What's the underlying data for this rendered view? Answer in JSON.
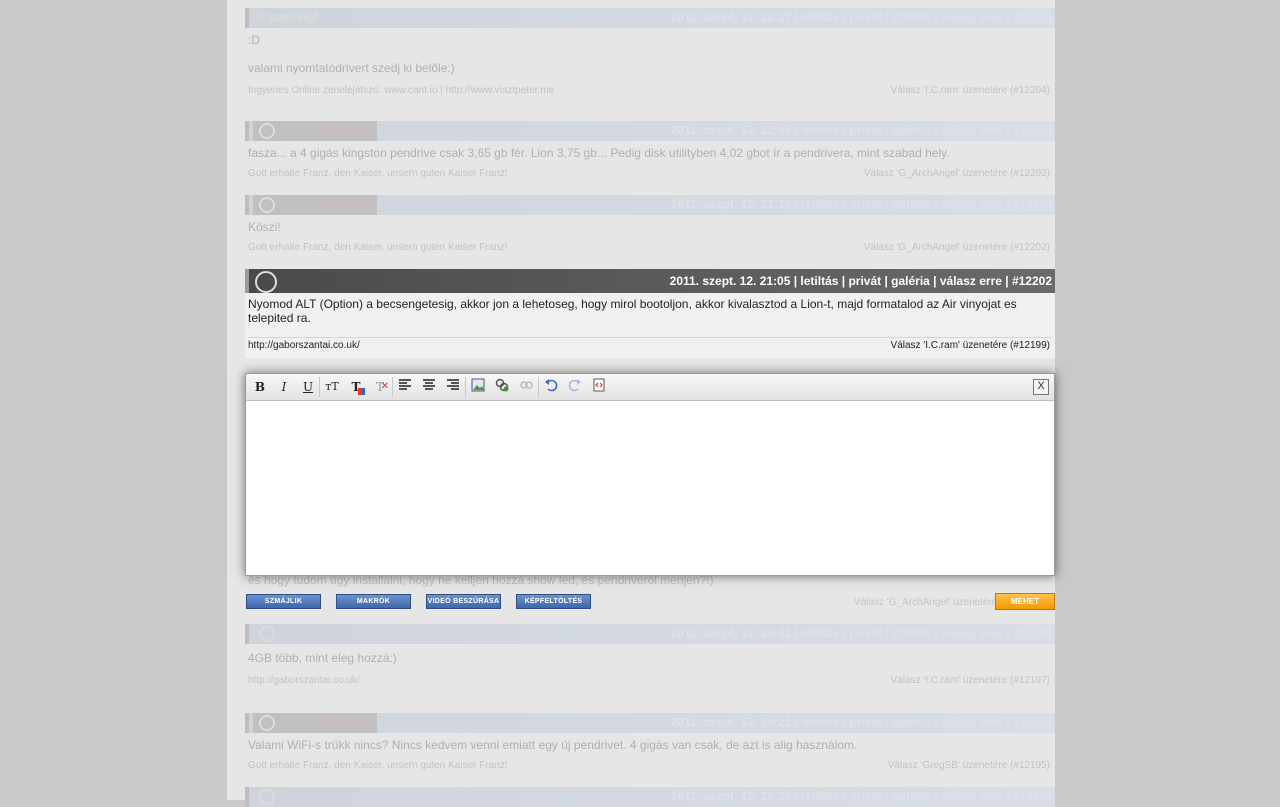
{
  "posts_top": [
    {
      "user": "© passaigt",
      "meta": "2011. szept. 12. 22:17 | letiltás | privát | galéria | válasz erre | #12205",
      "lines": [
        ":D",
        "valami nyomtatódrivert szedj ki belőle:)"
      ],
      "signature": "Ingyenes Online zenelejátszó: www.cant.io | http://www.vísztpeter.me",
      "reply": "Válasz 'I.C.ram' üzenetére (#12204)"
    },
    {
      "user": "I.C.ram",
      "meta": "2011. szept. 12. 22:05 | letiltás | privát | galéria | válasz erre | #12204",
      "lines": [
        "fasza... a 4 gigás kingston pendrive csak 3,65 gb fér. Lion 3,75 gb... Pedig disk utilityben 4,02 gbot ír a pendrivera, mint szabad hely."
      ],
      "signature": "Gott erhalte Franz, den Kaiser, unsern guten Kaiser Franz!",
      "reply": "Válasz 'G_ArchAngel' üzenetére (#12202)"
    },
    {
      "user": "I.C.ram",
      "meta": "2011. szept. 12. 21:14 | letiltás | privát | galéria | válasz erre | #12203",
      "lines": [
        "Köszi!"
      ],
      "signature": "Gott erhalte Franz, den Kaiser, unsern guten Kaiser Franz!",
      "reply": "Válasz 'G_ArchAngel' üzenetére (#12202)"
    }
  ],
  "highlight": {
    "meta": "2011. szept. 12. 21:05 | letiltás | privát | galéria | válasz erre | #12202",
    "body": "Nyomod ALT (Option) a becsengetesig, akkor jon a lehetoseg, hogy mirol bootoljon, akkor kivalasztod a Lion-t, majd formatalod az Air vinyojat es telepited ra.",
    "signature": "http://gaborszantai.co.uk/",
    "reply": "Válasz 'I.C.ram' üzenetére (#12199)"
  },
  "editor": {
    "toolbar": {
      "bold": "B",
      "italic": "I",
      "underline": "U",
      "font_size": "тT",
      "text_color": "T",
      "clear_format": "T",
      "close": "X"
    }
  },
  "hidden_line": "és hogy tudom úgy installálni, hogy ne kelljen hozzá show led, és pendriveról menjen?!)",
  "buttons": {
    "smileys": "SZMÁJLIK",
    "macros": "MAKRÓK",
    "video": "VIDEÓ BESZÚRÁSA",
    "image_upload": "KÉPFELTÖLTÉS",
    "send": "MEHET",
    "reply_text": "Válasz 'G_ArchAngel' üzenetére"
  },
  "posts_bottom": [
    {
      "meta": "2011. szept. 12. 20:41 | letiltás | privát | galéria | válasz erre | #12198",
      "lines": [
        "4GB több, mint eleg hozzá:)"
      ],
      "signature": "http://gaborszantai.co.uk/",
      "reply": "Válasz 'I.C.ram' üzenetére (#12197)"
    },
    {
      "user": "I.C.ram",
      "meta": "2011. szept. 12. 20:21 | letiltás | privát | galéria | válasz erre | #12197",
      "lines": [
        "Valami WiFi-s trükk nincs? Nincs kedvem venni emiatt egy új pendrivet. 4 gigás van csak, de azt is alig használom."
      ],
      "signature": "Gott erhalte Franz, den Kaiser, unsern guten Kaiser Franz!",
      "reply": "Válasz 'GregSB' üzenetére (#12195)"
    },
    {
      "meta": "2011. szept. 12. 19:25 | letiltás | privát | galéria | válasz erre | #12196"
    }
  ]
}
